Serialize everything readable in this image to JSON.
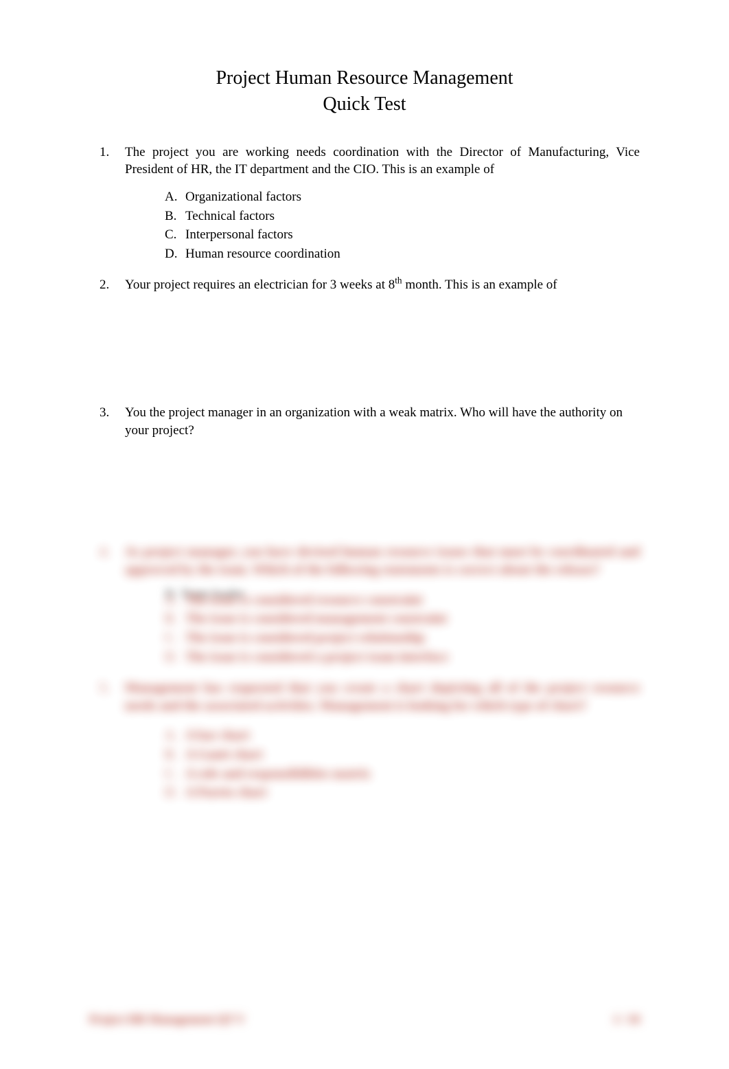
{
  "title": {
    "line1": "Project Human Resource Management",
    "line2": "Quick Test"
  },
  "questions": [
    {
      "num": "1.",
      "text": "The project you are working needs coordination with the Director of Manufacturing, Vice President of HR, the IT department and the CIO. This is an example of",
      "options": [
        {
          "letter": "A.",
          "text": "Organizational factors"
        },
        {
          "letter": "B.",
          "text": "Technical factors"
        },
        {
          "letter": "C.",
          "text": "Interpersonal factors"
        },
        {
          "letter": "D.",
          "text": "Human resource coordination"
        }
      ]
    },
    {
      "num": "2.",
      "text_pre": "Your project requires an electrician for 3 weeks at 8",
      "text_sup": "th",
      "text_post": " month. This is an example of",
      "options": []
    },
    {
      "num": "3.",
      "text": "You the project manager in an organization with a weak matrix. Who will have the authority on your project?",
      "options": []
    }
  ],
  "hidden": {
    "optD": "D.  Team leader",
    "q4": {
      "num": "4.",
      "text": "As project manager, you have devised human resource issues that must be coordinated and approved by the team. Which of the following statements is correct about the release?",
      "options": [
        {
          "letter": "A.",
          "text": "The issue is considered resource constraint"
        },
        {
          "letter": "B.",
          "text": "The issue is considered management  constraint"
        },
        {
          "letter": "C.",
          "text": "The issue is considered project relationship"
        },
        {
          "letter": "D.",
          "text": "The issue is considered a project team interface"
        }
      ]
    },
    "q5": {
      "num": "5.",
      "text": "Management has requested that you create a chart depicting all of the project resource needs and the associated activities. Management is looking for which type of chart?",
      "options": [
        {
          "letter": "A.",
          "text": "A bar chart"
        },
        {
          "letter": "B.",
          "text": "A Gantt chart"
        },
        {
          "letter": "C.",
          "text": "A role and responsibilities matrix"
        },
        {
          "letter": "D.",
          "text": "A Pareto chart"
        }
      ]
    }
  },
  "footer": {
    "left": "Project HR Management QT   V",
    "right": "1 / 10"
  }
}
